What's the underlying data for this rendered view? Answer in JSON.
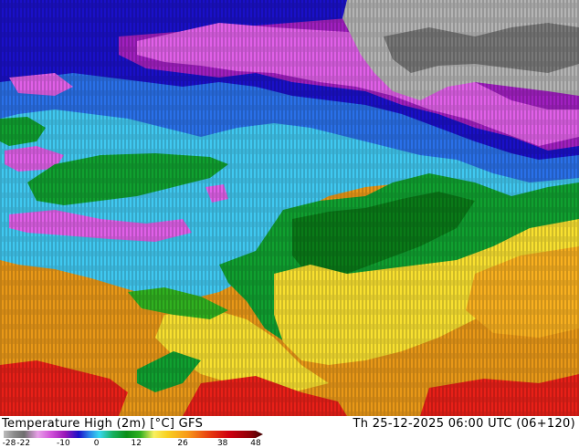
{
  "header": {
    "title": "Temperature High (2m) [°C] GFS",
    "valid_time": "Th 25-12-2025 06:00 UTC (06+120)"
  },
  "colorbar": {
    "tick_labels": [
      "-28",
      "-22",
      "-10",
      "0",
      "12",
      "26",
      "38",
      "48"
    ],
    "tick_values": [
      -28,
      -22,
      -10,
      0,
      12,
      26,
      38,
      48
    ],
    "range": [
      -28,
      48
    ],
    "colors": [
      {
        "v": -28,
        "c": "#bdbdbd"
      },
      {
        "v": -25,
        "c": "#8c8c8c"
      },
      {
        "v": -22,
        "c": "#6e6e6e"
      },
      {
        "v": -18,
        "c": "#e8a0e8"
      },
      {
        "v": -14,
        "c": "#d050d8"
      },
      {
        "v": -10,
        "c": "#9a18b8"
      },
      {
        "v": -6,
        "c": "#1a10c8"
      },
      {
        "v": -3,
        "c": "#2a80e8"
      },
      {
        "v": 0,
        "c": "#38d8f0"
      },
      {
        "v": 4,
        "c": "#18b060"
      },
      {
        "v": 8,
        "c": "#0a9018"
      },
      {
        "v": 12,
        "c": "#30b020"
      },
      {
        "v": 16,
        "c": "#f8f060"
      },
      {
        "v": 20,
        "c": "#f8d020"
      },
      {
        "v": 26,
        "c": "#f89818"
      },
      {
        "v": 32,
        "c": "#e84010"
      },
      {
        "v": 38,
        "c": "#d00010"
      },
      {
        "v": 44,
        "c": "#900008"
      },
      {
        "v": 48,
        "c": "#400000"
      }
    ]
  },
  "map_colors": {
    "grey_light": "#b4b4b4",
    "grey_dark": "#787878",
    "magenta": "#e060e8",
    "purple": "#a020c0",
    "navy": "#1a10c8",
    "blue": "#2a70e8",
    "cyan": "#40c8f0",
    "green": "#10a030",
    "dark_green": "#0a7a18",
    "yellow": "#f8e030",
    "orange": "#f89818",
    "red": "#e82018"
  }
}
